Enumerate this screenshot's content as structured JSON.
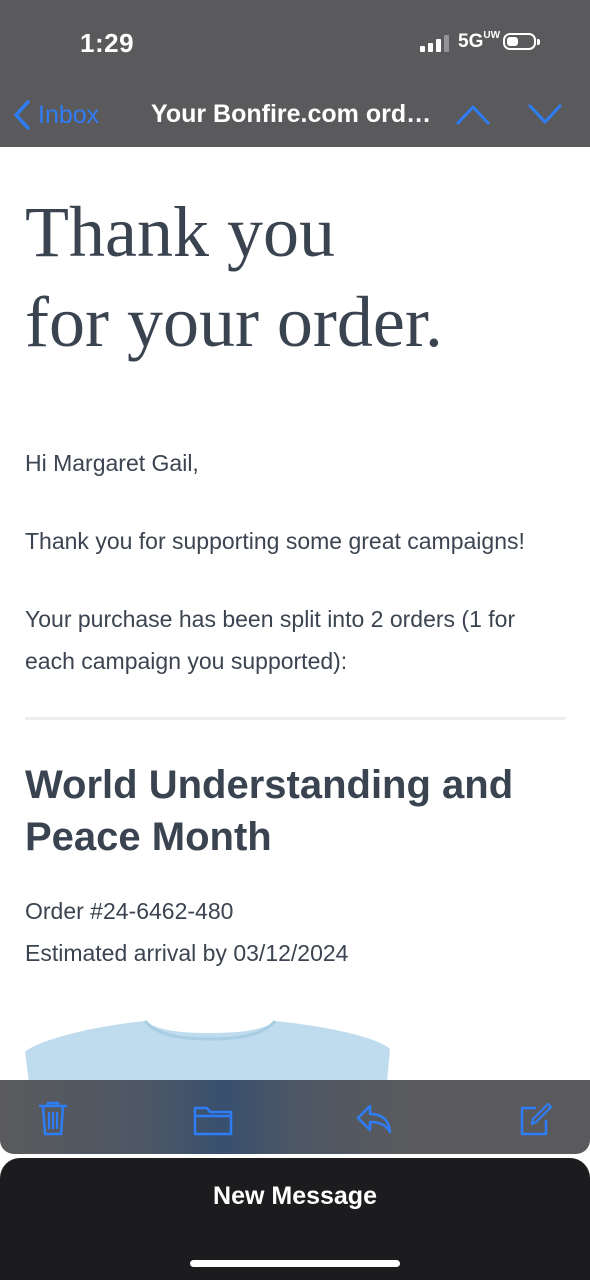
{
  "status_bar": {
    "time": "1:29",
    "network": "5G",
    "network_suffix": "UW",
    "signal_bars": 3,
    "battery_level": 0.3
  },
  "nav": {
    "back_label": "Inbox",
    "title": "Your Bonfire.com order...",
    "accent_color": "#2f7df6"
  },
  "email": {
    "headline_line1": "Thank you",
    "headline_line2": "for your order.",
    "greeting": "Hi Margaret Gail,",
    "thanks": "Thank you for supporting some great campaigns!",
    "split_info": "Your purchase has been split into 2 orders (1 for each campaign you supported):",
    "campaign_title": "World Understanding and Peace Month",
    "order_number": "Order #24-6462-480",
    "estimated_arrival": "Estimated arrival by 03/12/2024"
  },
  "toolbar": {
    "icons": [
      "trash-icon",
      "folder-icon",
      "reply-icon",
      "compose-icon"
    ]
  },
  "bottom": {
    "new_message_label": "New Message"
  }
}
